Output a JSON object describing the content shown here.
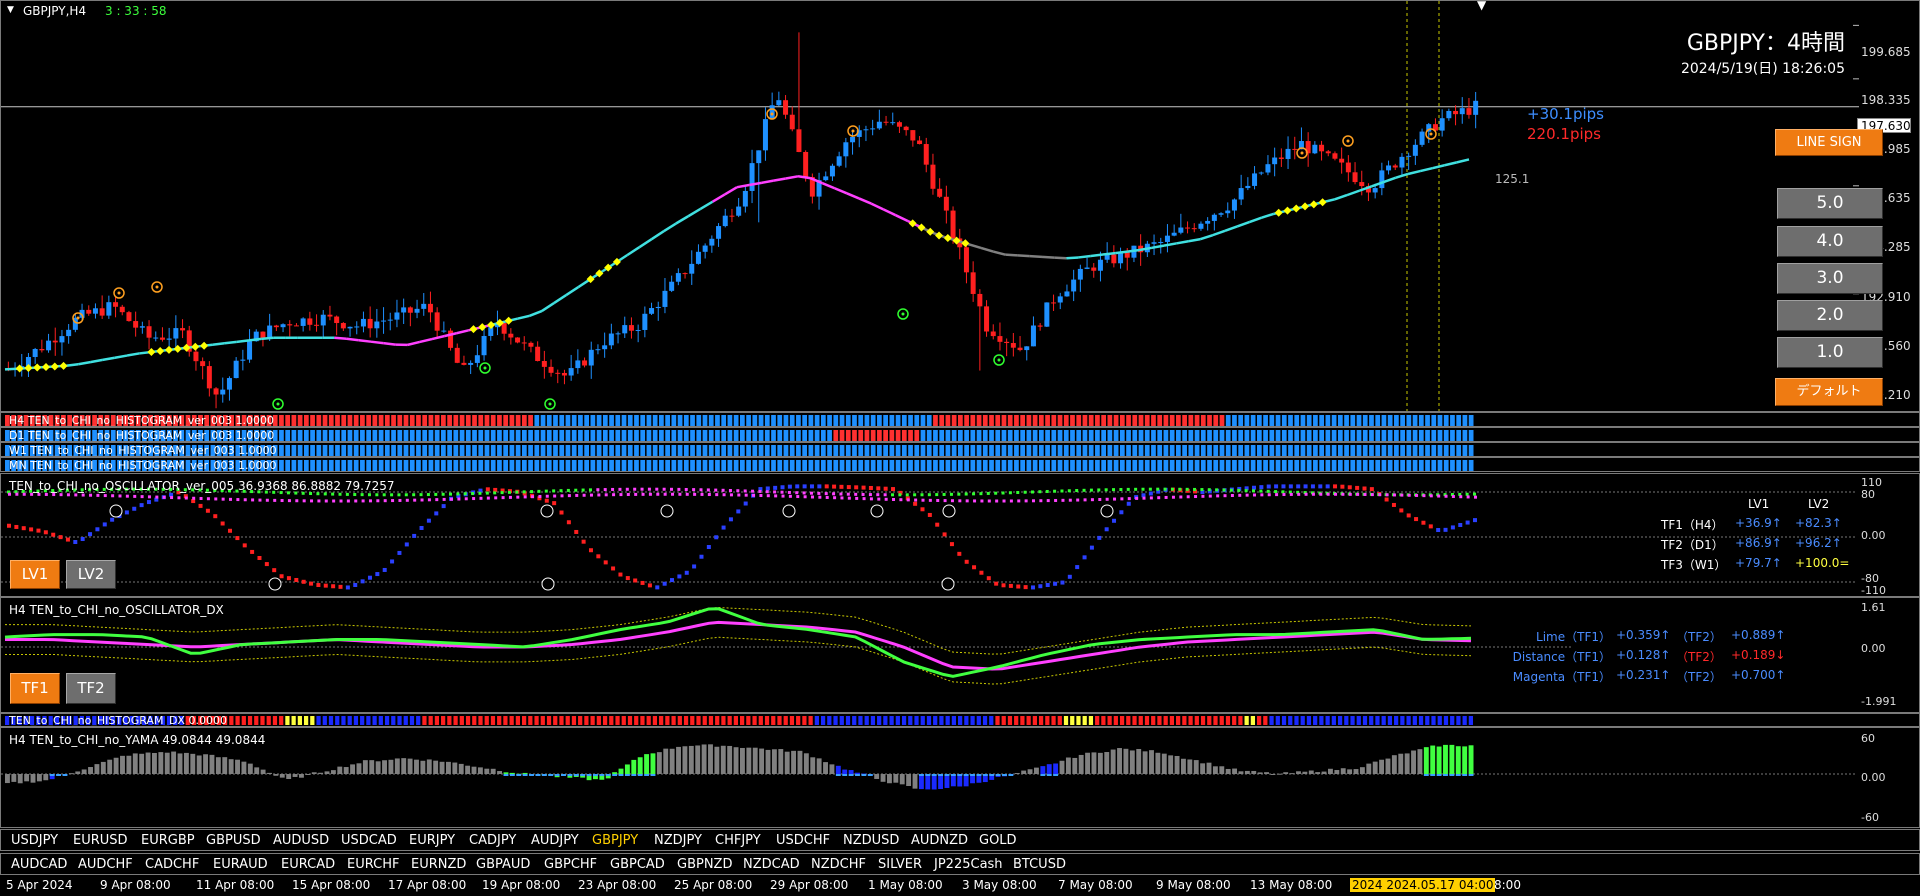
{
  "header": {
    "symbol": "GBPJPY,H4",
    "countdown": "3 : 33 : 58"
  },
  "title": {
    "main": "GBPJPY：4時間",
    "datetime": "2024/5/19(日) 18:26:05"
  },
  "price_axis": [
    "199.685",
    "198.335",
    "196.985",
    "195.635",
    "194.285",
    "192.910",
    "191.560",
    "190.210"
  ],
  "current_price": "197.630",
  "pips": {
    "plus": "+30.1pips",
    "range": "220.1pips",
    "level": "125.1"
  },
  "buttons": {
    "line_sign": "LINE SIGN",
    "levels": [
      "5.0",
      "4.0",
      "3.0",
      "2.0",
      "1.0"
    ],
    "default": "デフォルト"
  },
  "histograms": [
    "H4 TEN_to_CHI_no_HISTOGRAM_ver_003 1.0000",
    "D1 TEN_to_CHI_no_HISTOGRAM_ver_003 1.0000",
    "W1 TEN_to_CHI_no_HISTOGRAM_ver_003 1.0000",
    "MN TEN_to_CHI_no_HISTOGRAM_ver_003 1.0000"
  ],
  "oscillator": {
    "label": "TEN_to_CHI_no_OSCILLATOR_ver_005 36.9368 86.8882 79.7257",
    "axis": [
      "110",
      "80",
      "0.00",
      "-80",
      "-110"
    ],
    "btn_lv1": "LV1",
    "btn_lv2": "LV2",
    "col_lv1": "LV1",
    "col_lv2": "LV2",
    "rows": [
      {
        "tf": "TF1（H4）",
        "lv1": "+36.9↑",
        "lv2": "+82.3↑"
      },
      {
        "tf": "TF2（D1）",
        "lv1": "+86.9↑",
        "lv2": "+96.2↑"
      },
      {
        "tf": "TF3（W1）",
        "lv1": "+79.7↑",
        "lv2": "+100.0="
      }
    ]
  },
  "dx": {
    "label": "H4 TEN_to_CHI_no_OSCILLATOR_DX",
    "axis": [
      "1.61",
      "0.00",
      "-1.991"
    ],
    "btn_tf1": "TF1",
    "btn_tf2": "TF2",
    "rows": [
      {
        "name": "Lime（TF1）",
        "v1": "+0.359↑",
        "tf2": "（TF2）",
        "v2": "+0.889↑"
      },
      {
        "name": "Distance（TF1）",
        "v1": "+0.128↑",
        "tf2": "（TF2）",
        "v2": "+0.189↓"
      },
      {
        "name": "Magenta（TF1）",
        "v1": "+0.231↑",
        "tf2": "（TF2）",
        "v2": "+0.700↑"
      }
    ]
  },
  "hist_dx": {
    "label": "TEN_to_CHI_no_HISTOGRAM_DX 0.0000"
  },
  "yama": {
    "label": "H4  TEN_to_CHI_no_YAMA 49.0844 49.0844",
    "axis": [
      "60",
      "0.00",
      "-60"
    ]
  },
  "pairs_row1": [
    "USDJPY",
    "EURUSD",
    "EURGBP",
    "GBPUSD",
    "AUDUSD",
    "USDCAD",
    "EURJPY",
    "CADJPY",
    "AUDJPY",
    "GBPJPY",
    "NZDJPY",
    "CHFJPY",
    "USDCHF",
    "NZDUSD",
    "AUDNZD",
    "GOLD"
  ],
  "pairs_row2": [
    "AUDCAD",
    "AUDCHF",
    "CADCHF",
    "EURAUD",
    "EURCAD",
    "EURCHF",
    "EURNZD",
    "GBPAUD",
    "GBPCHF",
    "GBPCAD",
    "GBPNZD",
    "NZDCAD",
    "NZDCHF",
    "SILVER",
    "JP225Cash",
    "BTCUSD"
  ],
  "active_pair": "GBPJPY",
  "dates": [
    "5 Apr 2024",
    "9 Apr 08:00",
    "11 Apr 08:00",
    "15 Apr 08:00",
    "17 Apr 08:00",
    "19 Apr 08:00",
    "23 Apr 08:00",
    "25 Apr 08:00",
    "29 Apr 08:00",
    "1 May 08:00",
    "3 May 08:00",
    "7 May 08:00",
    "9 May 08:00",
    "13 May 08:00",
    "2024.05.17 04:00",
    "8:00"
  ],
  "colors": {
    "bull": "#1e90ff",
    "bear": "#ff2020",
    "cyan": "#40e0e0",
    "magenta": "#ff40ff",
    "lime": "#40ff40",
    "orange": "#ef7b12",
    "yellow": "#ffff00"
  },
  "chart_data": {
    "type": "candlestick",
    "symbol": "GBPJPY",
    "timeframe": "H4",
    "ylim": [
      189.9,
      200.3
    ],
    "yticks": [
      199.685,
      198.335,
      196.985,
      195.635,
      194.285,
      192.91,
      191.56,
      190.21
    ],
    "close_anchors": [
      191.0,
      191.6,
      192.3,
      192.6,
      191.8,
      191.9,
      190.3,
      191.8,
      192.2,
      192.3,
      192.1,
      192.3,
      192.6,
      190.9,
      192.2,
      191.4,
      190.8,
      191.7,
      192.1,
      193.1,
      194.2,
      195.4,
      198.0,
      195.5,
      196.8,
      197.3,
      196.8,
      194.5,
      192.1,
      191.5,
      192.9,
      193.6,
      193.9,
      194.2,
      194.7,
      195.2,
      196.1,
      196.7,
      196.2,
      195.6,
      196.5,
      197.3,
      197.63
    ],
    "ema_cyan": [
      191.0,
      191.1,
      191.4,
      191.6,
      191.8,
      191.8,
      191.6,
      192.0,
      192.4,
      193.5,
      194.6,
      195.6,
      195.9,
      195.2,
      194.4,
      193.9,
      193.8,
      194.0,
      194.3,
      194.9,
      195.3,
      195.9,
      196.3
    ],
    "current_price": 197.63
  }
}
